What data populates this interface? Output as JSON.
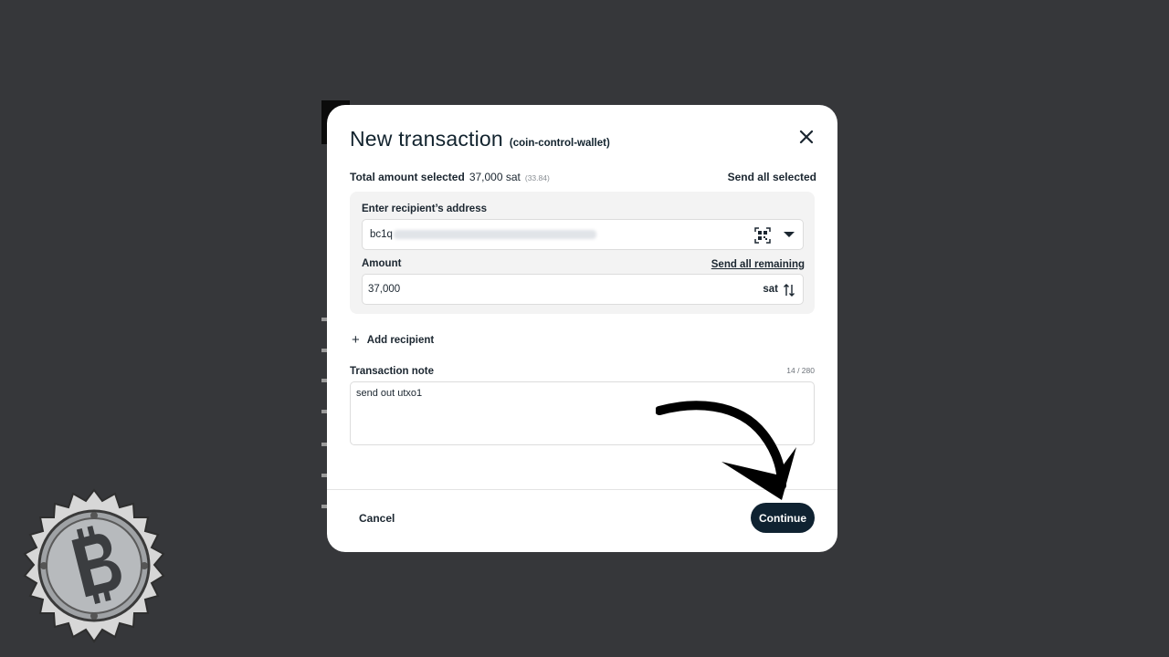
{
  "dialog": {
    "title": "New transaction",
    "wallet_name": "(coin-control-wallet)",
    "close_icon": "close-icon"
  },
  "summary": {
    "total_label": "Total amount selected",
    "total_value": "37,000 sat",
    "total_fiat": "(33.84)",
    "send_all_selected": "Send all selected"
  },
  "recipient": {
    "address_label": "Enter recipient’s address",
    "address_prefix": "bc1q",
    "qr_icon": "qr-scan-icon",
    "dropdown_icon": "chevron-down-icon",
    "amount_label": "Amount",
    "send_all_remaining": "Send all remaining",
    "amount_value": "37,000",
    "unit": "sat",
    "swap_icon": "swap-vertical-icon"
  },
  "add_recipient": {
    "icon": "+",
    "label": "Add recipient"
  },
  "note": {
    "label": "Transaction note",
    "counter": "14 / 280",
    "value": "send out utxo1"
  },
  "footer": {
    "cancel_label": "Cancel",
    "continue_label": "Continue"
  },
  "colors": {
    "background": "#36373a",
    "primary_button": "#0f2231",
    "text": "#1b2630"
  }
}
